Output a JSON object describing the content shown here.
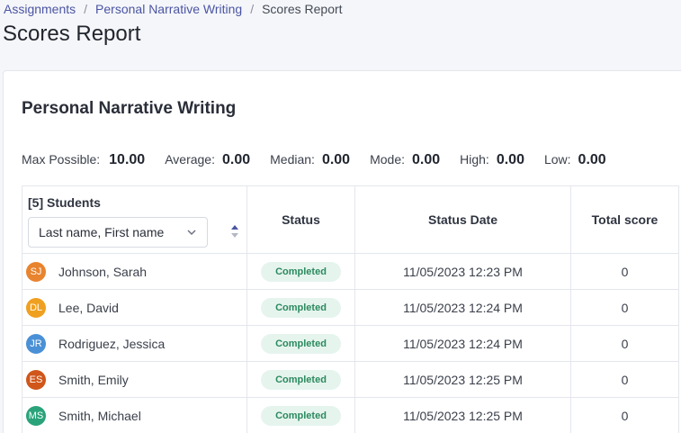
{
  "breadcrumb": {
    "items": [
      "Assignments",
      "Personal Narrative Writing"
    ],
    "current": "Scores Report",
    "separator": "/"
  },
  "page_title": "Scores Report",
  "card": {
    "title": "Personal Narrative Writing",
    "stats": [
      {
        "label": "Max Possible:",
        "value": "10.00"
      },
      {
        "label": "Average:",
        "value": "0.00"
      },
      {
        "label": "Median:",
        "value": "0.00"
      },
      {
        "label": "Mode:",
        "value": "0.00"
      },
      {
        "label": "High:",
        "value": "0.00"
      },
      {
        "label": "Low:",
        "value": "0.00"
      }
    ]
  },
  "table": {
    "students_label": "[5] Students",
    "sort_value": "Last name, First name",
    "headers": {
      "status": "Status",
      "status_date": "Status Date",
      "total_score": "Total score"
    },
    "rows": [
      {
        "initials": "SJ",
        "avatar_color": "#e8832e",
        "name": "Johnson, Sarah",
        "status": "Completed",
        "date": "11/05/2023 12:23 PM",
        "score": "0"
      },
      {
        "initials": "DL",
        "avatar_color": "#f0a020",
        "name": "Lee, David",
        "status": "Completed",
        "date": "11/05/2023 12:24 PM",
        "score": "0"
      },
      {
        "initials": "JR",
        "avatar_color": "#4a90d6",
        "name": "Rodriguez, Jessica",
        "status": "Completed",
        "date": "11/05/2023 12:24 PM",
        "score": "0"
      },
      {
        "initials": "ES",
        "avatar_color": "#d0561a",
        "name": "Smith, Emily",
        "status": "Completed",
        "date": "11/05/2023 12:25 PM",
        "score": "0"
      },
      {
        "initials": "MS",
        "avatar_color": "#2aa37a",
        "name": "Smith, Michael",
        "status": "Completed",
        "date": "11/05/2023 12:25 PM",
        "score": "0"
      }
    ]
  }
}
